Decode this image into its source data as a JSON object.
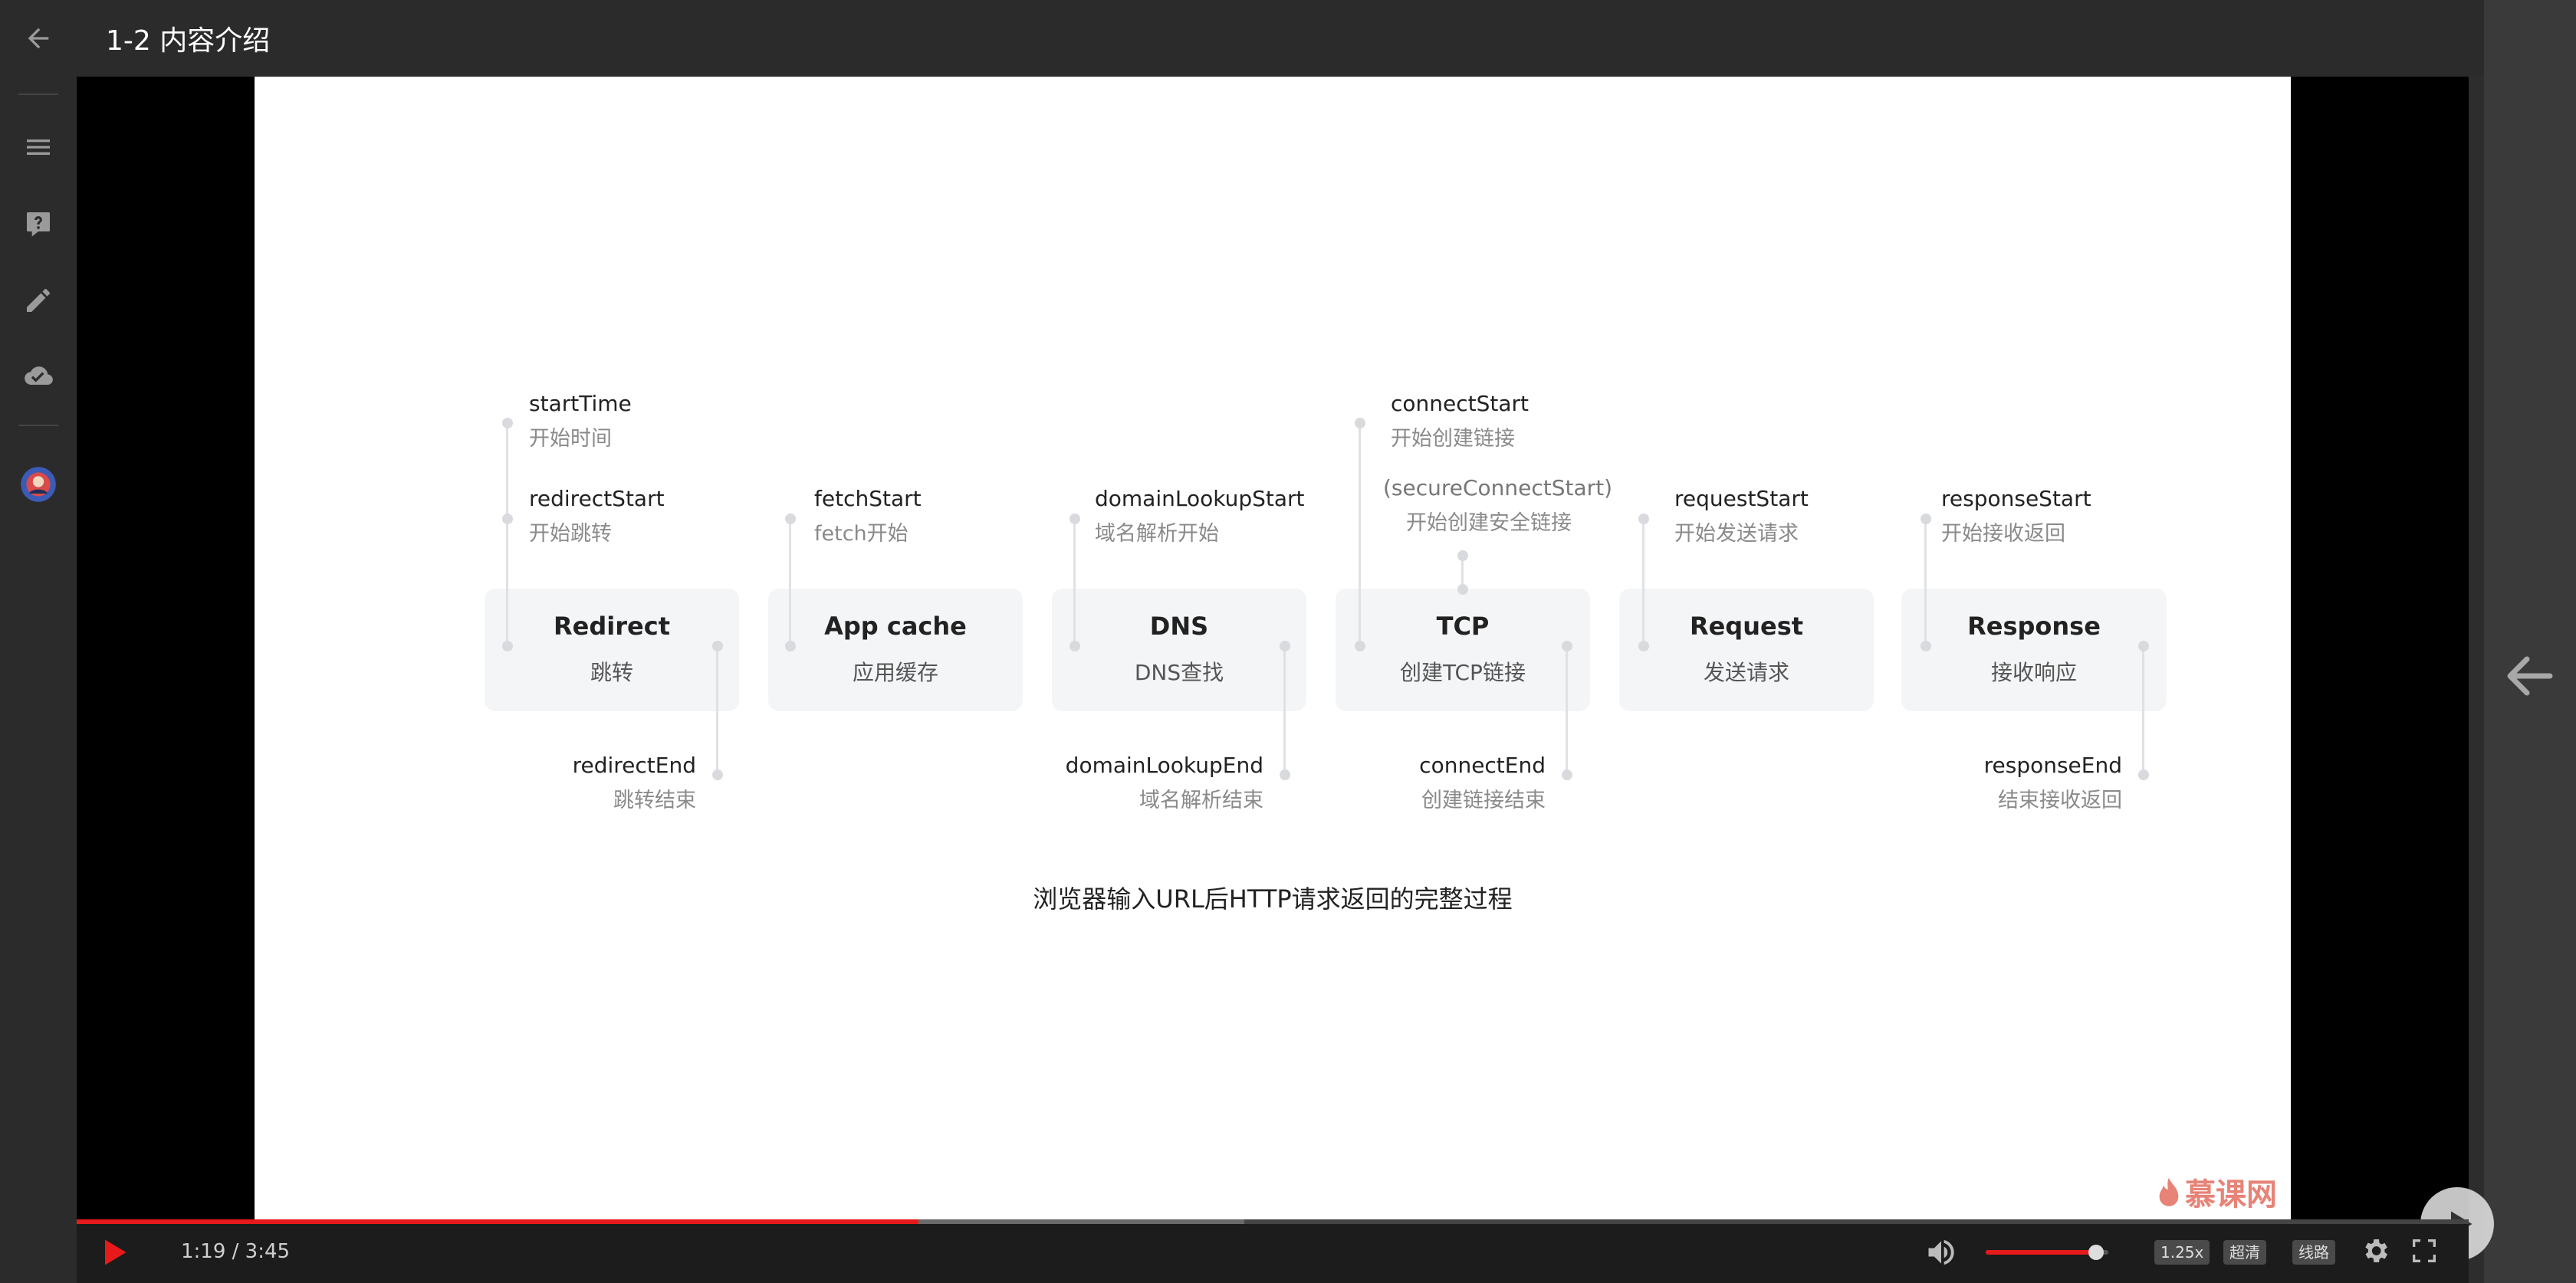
{
  "header": {
    "title": "1-2 内容介绍"
  },
  "slide": {
    "caption": "浏览器输入URL后HTTP请求返回的完整过程",
    "watermark": "慕课网",
    "stages": [
      {
        "name": "Redirect",
        "sub": "跳转"
      },
      {
        "name": "App cache",
        "sub": "应用缓存"
      },
      {
        "name": "DNS",
        "sub": "DNS查找"
      },
      {
        "name": "TCP",
        "sub": "创建TCP链接"
      },
      {
        "name": "Request",
        "sub": "发送请求"
      },
      {
        "name": "Response",
        "sub": "接收响应"
      }
    ],
    "events_top": [
      {
        "name": "startTime",
        "cn": "开始时间"
      },
      {
        "name": "redirectStart",
        "cn": "开始跳转"
      },
      {
        "name": "fetchStart",
        "cn": "fetch开始"
      },
      {
        "name": "domainLookupStart",
        "cn": "域名解析开始"
      },
      {
        "name": "connectStart",
        "cn": "开始创建链接"
      },
      {
        "name": "(secureConnectStart)",
        "cn": "开始创建安全链接"
      },
      {
        "name": "requestStart",
        "cn": "开始发送请求"
      },
      {
        "name": "responseStart",
        "cn": "开始接收返回"
      }
    ],
    "events_bottom": [
      {
        "name": "redirectEnd",
        "cn": "跳转结束"
      },
      {
        "name": "domainLookupEnd",
        "cn": "域名解析结束"
      },
      {
        "name": "connectEnd",
        "cn": "创建链接结束"
      },
      {
        "name": "responseEnd",
        "cn": "结束接收返回"
      }
    ]
  },
  "player": {
    "time": "1:19 / 3:45",
    "progress": 0.352,
    "buffered": 0.488,
    "volume": 0.9,
    "speed_label": "1.25x",
    "quality_label": "超清",
    "line_label": "线路"
  }
}
